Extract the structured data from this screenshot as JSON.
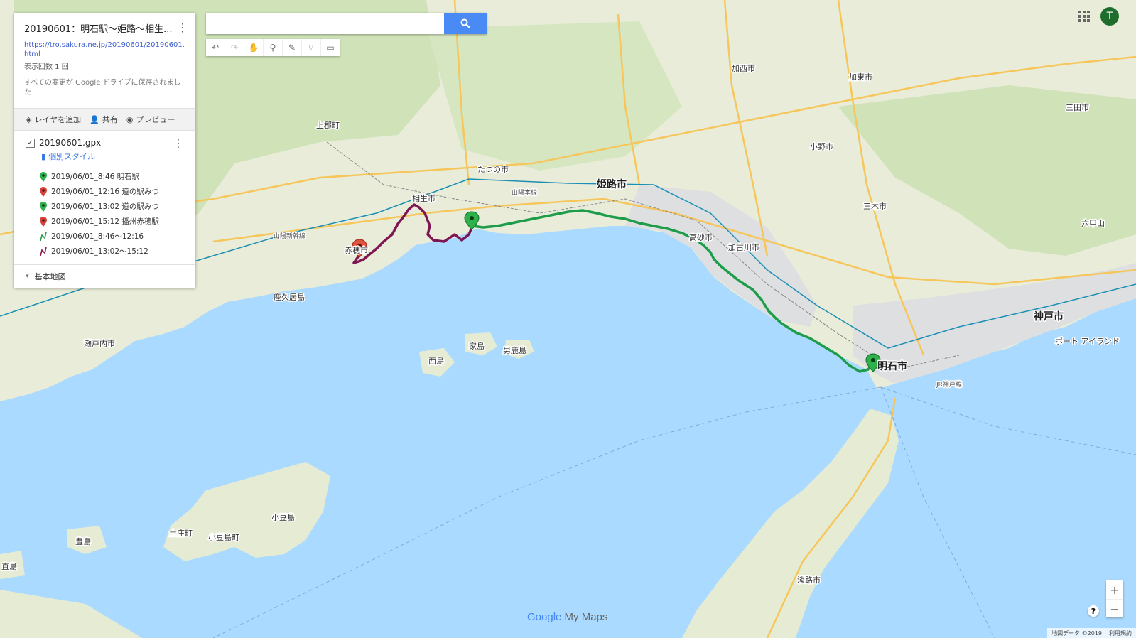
{
  "panel": {
    "title": "20190601：明石駅〜姫路〜相生...",
    "url": "https://tro.sakura.ne.jp/20190601/20190601.html",
    "views": "表示回数 1 回",
    "saved": "すべての変更が Google ドライブに保存されました",
    "actions": {
      "add_layer": "レイヤを追加",
      "share": "共有",
      "preview": "プレビュー"
    },
    "layer": {
      "name": "20190601.gpx",
      "style": "個別スタイル",
      "items": [
        {
          "label": "2019/06/01_8:46 明石駅",
          "color": "#2db14a",
          "kind": "pin"
        },
        {
          "label": "2019/06/01_12:16 道の駅みつ",
          "color": "#d9423a",
          "kind": "pin"
        },
        {
          "label": "2019/06/01_13:02 道の駅みつ",
          "color": "#2db14a",
          "kind": "pin"
        },
        {
          "label": "2019/06/01_15:12 播州赤穂駅",
          "color": "#d9423a",
          "kind": "pin"
        },
        {
          "label": "2019/06/01_8:46〜12:16",
          "color": "#2e9e4a",
          "kind": "line"
        },
        {
          "label": "2019/06/01_13:02〜15:12",
          "color": "#8b1a52",
          "kind": "line"
        }
      ]
    },
    "base_map": "基本地図"
  },
  "search": {
    "placeholder": ""
  },
  "account": {
    "initial": "T"
  },
  "brand": {
    "google": "Google",
    "product": "My Maps"
  },
  "footer": {
    "data": "地図データ ©2019",
    "terms": "利用規約"
  },
  "map": {
    "labels": {
      "kobe": "神戸市",
      "akashi": "明石市",
      "himeji": "姫路市",
      "aioi": "相生市",
      "ako": "赤穂市",
      "tatsuno": "たつの市",
      "takasago": "高砂市",
      "kakogawa": "加古川市",
      "kasai": "加西市",
      "kato": "加東市",
      "ono": "小野市",
      "miki": "三木市",
      "sanda": "三田市",
      "awaji": "淡路市",
      "shodoshima": "小豆島",
      "tonosho": "土庄町",
      "shodoshima_town": "小豆島町",
      "nishijima": "西島",
      "ieshima": "家島",
      "tanjima": "男鹿島",
      "setouchi": "瀬戸内市",
      "hinase": "鹿久居島",
      "teshima": "豊島",
      "naoshima": "直島",
      "kamigori": "上郡町",
      "rokko": "六甲山",
      "port": "ポート\nアイランド",
      "sanyo_shinkansen": "山陽新幹線",
      "sanyo_line": "山陽本線",
      "jr_kobe": "JR神戸線"
    },
    "route_green": "8:46〜12:16",
    "route_purple": "13:02〜15:12"
  }
}
